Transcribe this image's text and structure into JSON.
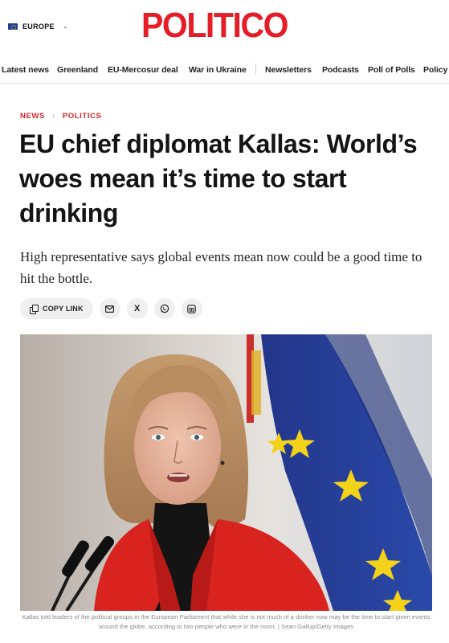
{
  "header": {
    "region_label": "EUROPE",
    "logo_text": "POLITICO"
  },
  "nav": {
    "items": [
      "Latest news",
      "Greenland",
      "EU-Mercosur deal",
      "War in Ukraine",
      "Newsletters",
      "Podcasts",
      "Poll of Polls",
      "Policy"
    ]
  },
  "breadcrumb": {
    "section": "NEWS",
    "subsection": "POLITICS"
  },
  "article": {
    "headline": "EU chief diplomat Kallas: World’s woes mean it’s time to start drinking",
    "dek": "High representative says global events mean now could be a good time to hit the bottle.",
    "caption": "Kallas told leaders of the political groups in the European Parliament that while she is not much of a drinker now may be the time to start given events around the globe, according to two people who were in the room. | Sean Gallup/Getty Images"
  },
  "share": {
    "copy_link_label": "COPY LINK",
    "x_label": "X"
  },
  "colors": {
    "brand_red": "#e41d27",
    "crumb_red": "#d7262d",
    "eu_blue": "#1f3f9c",
    "eu_star": "#f4d21a",
    "jacket_red": "#d9231f"
  },
  "icons": [
    "flag-icon",
    "chevron-down-icon",
    "copy-icon",
    "email-icon",
    "x-icon",
    "whatsapp-icon",
    "gift-icon"
  ]
}
